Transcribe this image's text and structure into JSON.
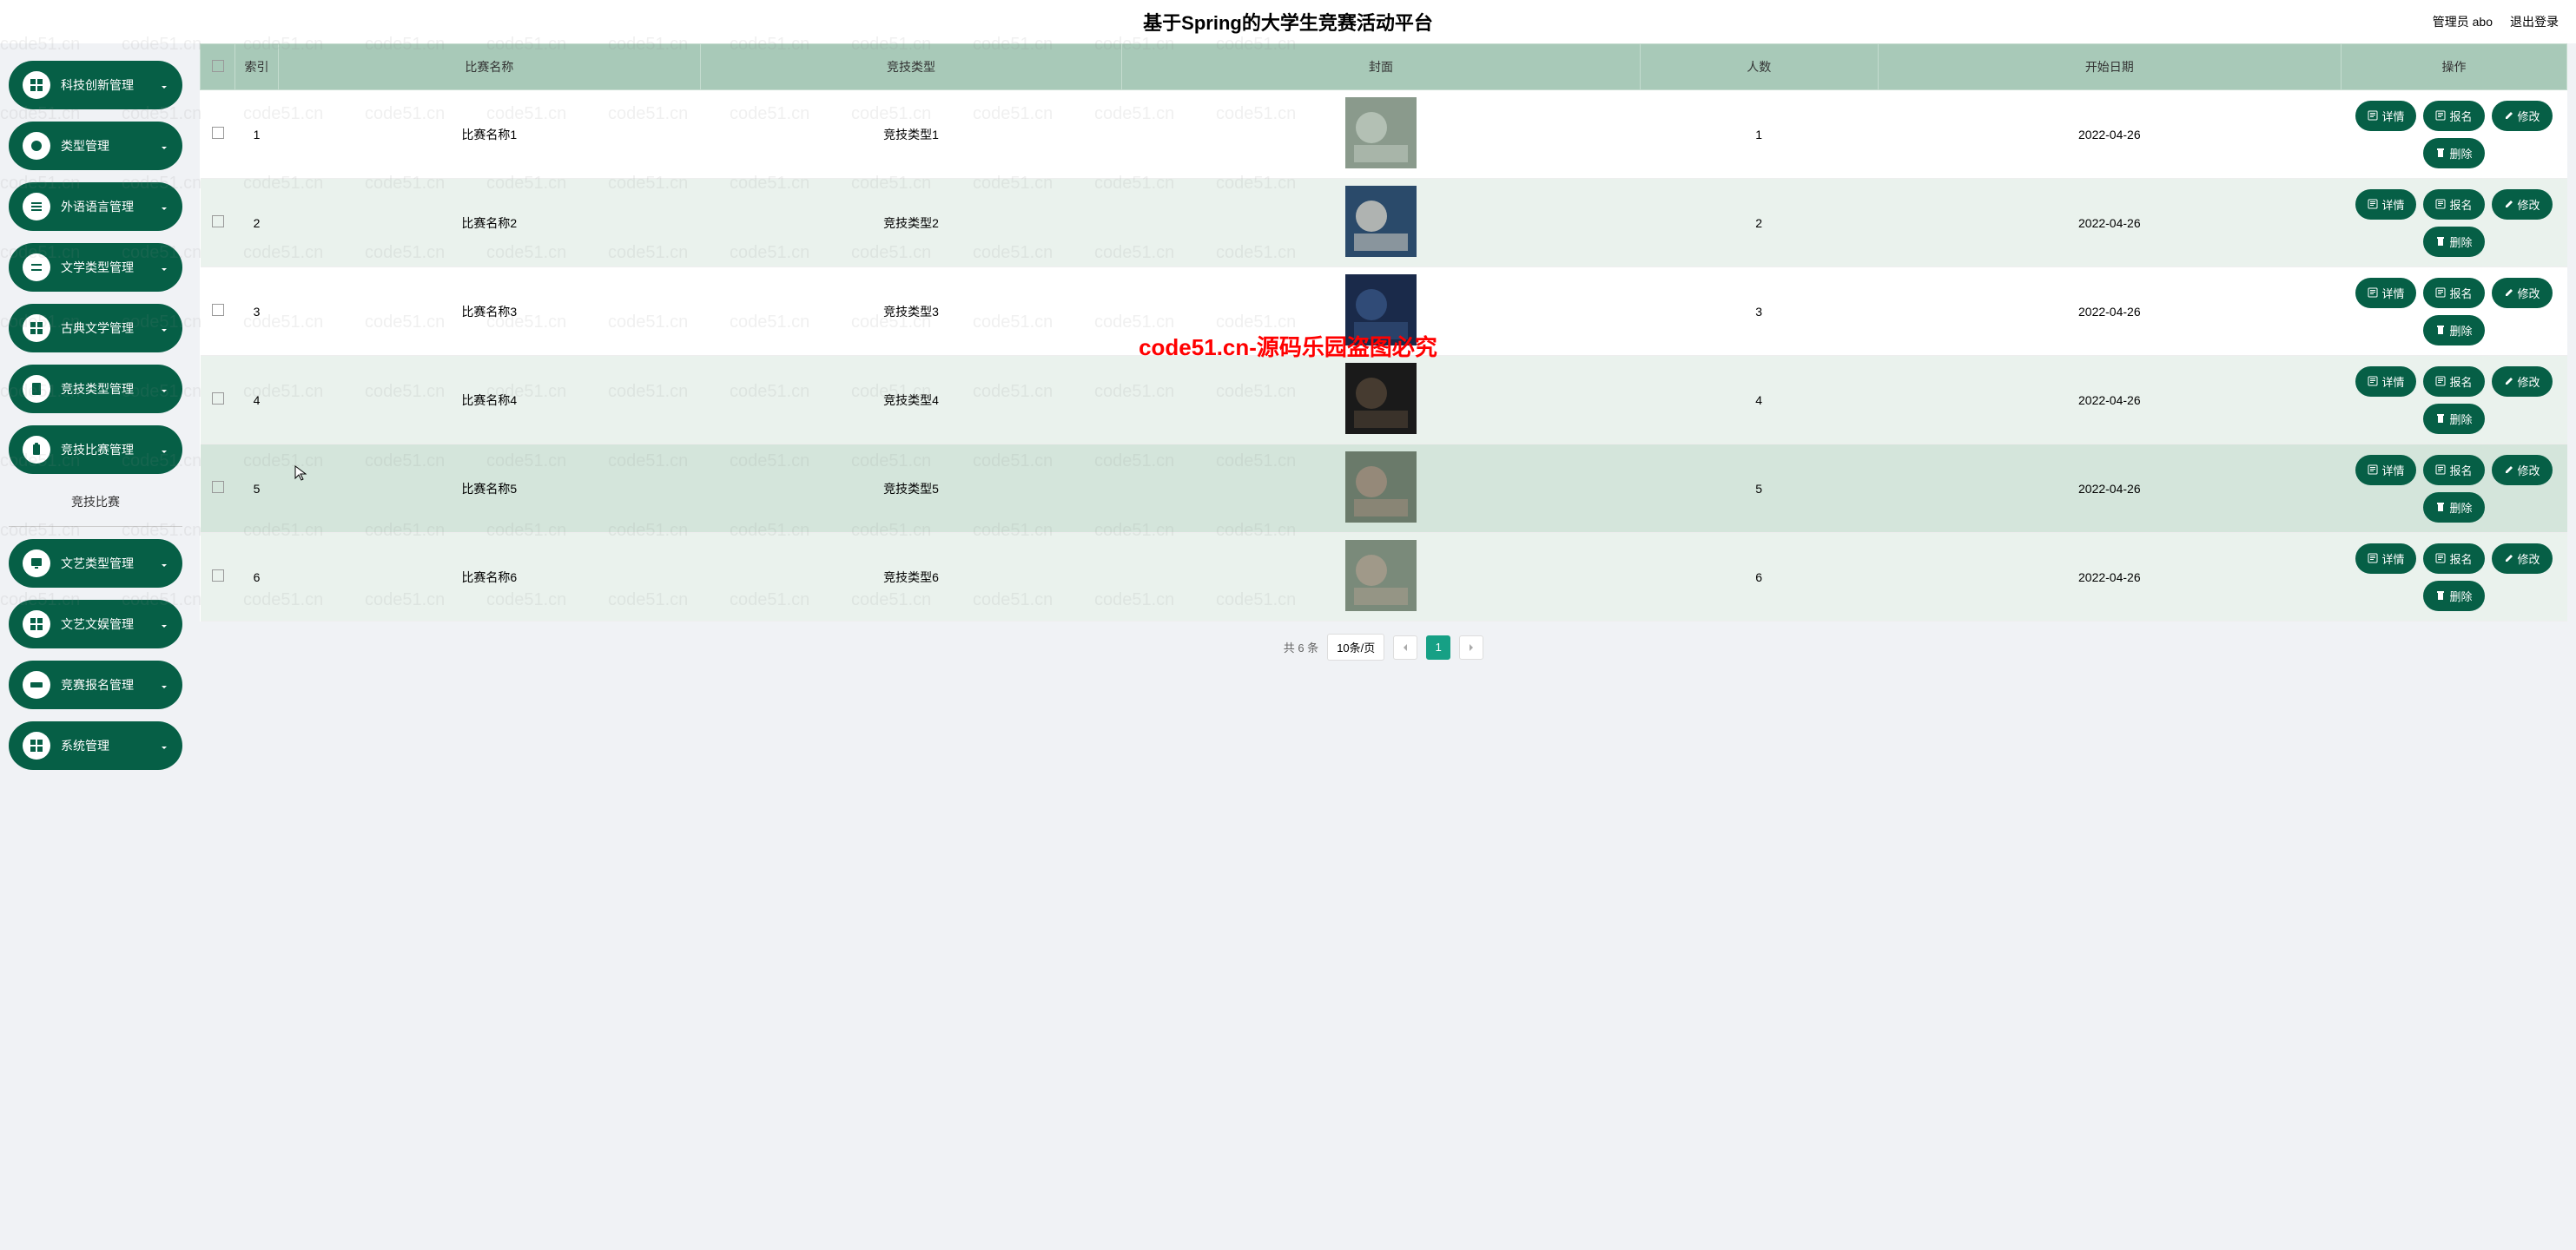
{
  "header": {
    "title": "基于Spring的大学生竞赛活动平台",
    "admin_label": "管理员 abo",
    "logout": "退出登录"
  },
  "sidebar": {
    "items": [
      {
        "label": "科技创新管理",
        "icon": "grid"
      },
      {
        "label": "类型管理",
        "icon": "circle"
      },
      {
        "label": "外语语言管理",
        "icon": "lines"
      },
      {
        "label": "文学类型管理",
        "icon": "bars"
      },
      {
        "label": "古典文学管理",
        "icon": "grid"
      },
      {
        "label": "竞技类型管理",
        "icon": "doc"
      },
      {
        "label": "竞技比赛管理",
        "icon": "clip"
      }
    ],
    "sub_label": "竞技比赛",
    "items2": [
      {
        "label": "文艺类型管理",
        "icon": "monitor"
      },
      {
        "label": "文艺文娱管理",
        "icon": "grid"
      },
      {
        "label": "竞赛报名管理",
        "icon": "ticket"
      },
      {
        "label": "系统管理",
        "icon": "grid"
      }
    ]
  },
  "table": {
    "columns": [
      "索引",
      "比赛名称",
      "竞技类型",
      "封面",
      "人数",
      "开始日期",
      "操作"
    ],
    "rows": [
      {
        "idx": "1",
        "name": "比赛名称1",
        "type": "竞技类型1",
        "num": "1",
        "date": "2022-04-26"
      },
      {
        "idx": "2",
        "name": "比赛名称2",
        "type": "竞技类型2",
        "num": "2",
        "date": "2022-04-26"
      },
      {
        "idx": "3",
        "name": "比赛名称3",
        "type": "竞技类型3",
        "num": "3",
        "date": "2022-04-26"
      },
      {
        "idx": "4",
        "name": "比赛名称4",
        "type": "竞技类型4",
        "num": "4",
        "date": "2022-04-26"
      },
      {
        "idx": "5",
        "name": "比赛名称5",
        "type": "竞技类型5",
        "num": "5",
        "date": "2022-04-26"
      },
      {
        "idx": "6",
        "name": "比赛名称6",
        "type": "竞技类型6",
        "num": "6",
        "date": "2022-04-26"
      }
    ],
    "actions": {
      "detail": "详情",
      "signup": "报名",
      "edit": "修改",
      "delete": "删除"
    }
  },
  "pagination": {
    "total_text": "共 6 条",
    "size_text": "10条/页",
    "current": "1"
  },
  "watermark": {
    "text": "code51.cn",
    "center": "code51.cn-源码乐园盗图必究"
  }
}
